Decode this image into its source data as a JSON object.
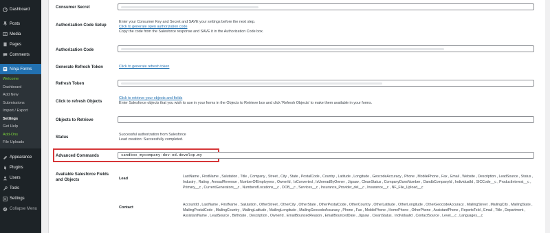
{
  "sidebar": {
    "top_items": [
      {
        "label": "Dashboard",
        "icon": "dashboard-icon"
      },
      {
        "label": "Posts",
        "icon": "pin-icon"
      },
      {
        "label": "Media",
        "icon": "media-icon"
      },
      {
        "label": "Pages",
        "icon": "page-icon"
      },
      {
        "label": "Comments",
        "icon": "comment-icon"
      }
    ],
    "active_item": {
      "label": "Ninja Forms",
      "icon": "ninja-forms-icon"
    },
    "submenu": [
      "Welcome",
      "Dashboard",
      "Add New",
      "Submissions",
      "Import / Export",
      "Settings",
      "Get Help",
      "Add-Ons",
      "File Uploads"
    ],
    "bottom_items": [
      {
        "label": "Appearance",
        "icon": "brush-icon"
      },
      {
        "label": "Plugins",
        "icon": "plugin-icon"
      },
      {
        "label": "Users",
        "icon": "user-icon"
      },
      {
        "label": "Tools",
        "icon": "wrench-icon"
      },
      {
        "label": "Settings",
        "icon": "settings-icon"
      },
      {
        "label": "Collapse Menu",
        "icon": "collapse-icon"
      }
    ]
  },
  "fields": {
    "consumer_secret": {
      "label": "Consumer Secret"
    },
    "auth_setup": {
      "label": "Authorization Code Setup",
      "line1": "Enter your Consumer Key and Secret and SAVE your settings before the next step.",
      "link": "Click to generate open authorization code",
      "line2": "Copy the code from the Salesforce response and SAVE it in the Authorization Code box."
    },
    "auth_code": {
      "label": "Authorization Code"
    },
    "refresh_token_gen": {
      "label": "Generate Refresh Token",
      "link": "Click to generate refresh token"
    },
    "refresh_token": {
      "label": "Refresh Token"
    },
    "refresh_objects": {
      "label": "Click to refresh Objects",
      "link": "Click to retrieve your objects and fields",
      "line": "Enter Salesforce objects that you wish to use in your forms in the Objects to Retrieve box and click 'Refresh Objects' to make them available in your forms."
    },
    "objects_retrieve": {
      "label": "Objects to Retrieve"
    },
    "status": {
      "label": "Status",
      "line1": "Successful authorization from Salesforce",
      "line2": "Lead creation: Successfully completed."
    },
    "advanced": {
      "label": "Advanced Commands",
      "value": "sandbox_mycompany-dev-ed.develop.my"
    },
    "available": {
      "label": "Available Salesforce Fields and Objects",
      "lead_label": "Lead",
      "lead_fields": "LastName , FirstName , Salutation , Title , Company , Street , City , State , PostalCode , Country , Latitude , Longitude , GeocodeAccuracy , Phone , MobilePhone , Fax , Email , Website , Description , LeadSource , Status , Industry , Rating , AnnualRevenue , NumberOfEmployees , OwnerId , IsConverted , IsUnreadByOwner , Jigsaw , CleanStatus , CompanyDunsNumber , DandbCompanyId , IndividualId , SICCode__c , ProductInterest__c , Primary__c , CurrentGenerators__c , NumberofLocations__c , DOB__c , Services__c , Insurance_Provider_del__c , Insurance__c , NF_File_Upload__c",
      "contact_label": "Contact",
      "contact_fields": "AccountId , LastName , FirstName , Salutation , OtherStreet , OtherCity , OtherState , OtherPostalCode , OtherCountry , OtherLatitude , OtherLongitude , OtherGeocodeAccuracy , MailingStreet , MailingCity , MailingState , MailingPostalCode , MailingCountry , MailingLatitude , MailingLongitude , MailingGeocodeAccuracy , Phone , Fax , MobilePhone , HomePhone , OtherPhone , AssistantPhone , ReportsToId , Email , Title , Department , AssistantName , LeadSource , Birthdate , Description , OwnerId , EmailBouncedReason , EmailBouncedDate , Jigsaw , CleanStatus , IndividualId , ContactSource , Level__c , Languages__c"
    }
  },
  "colors": {
    "sidebar": "#1d2327",
    "active": "#2271b1",
    "link": "#2271b1",
    "highlight": "#d63638"
  }
}
